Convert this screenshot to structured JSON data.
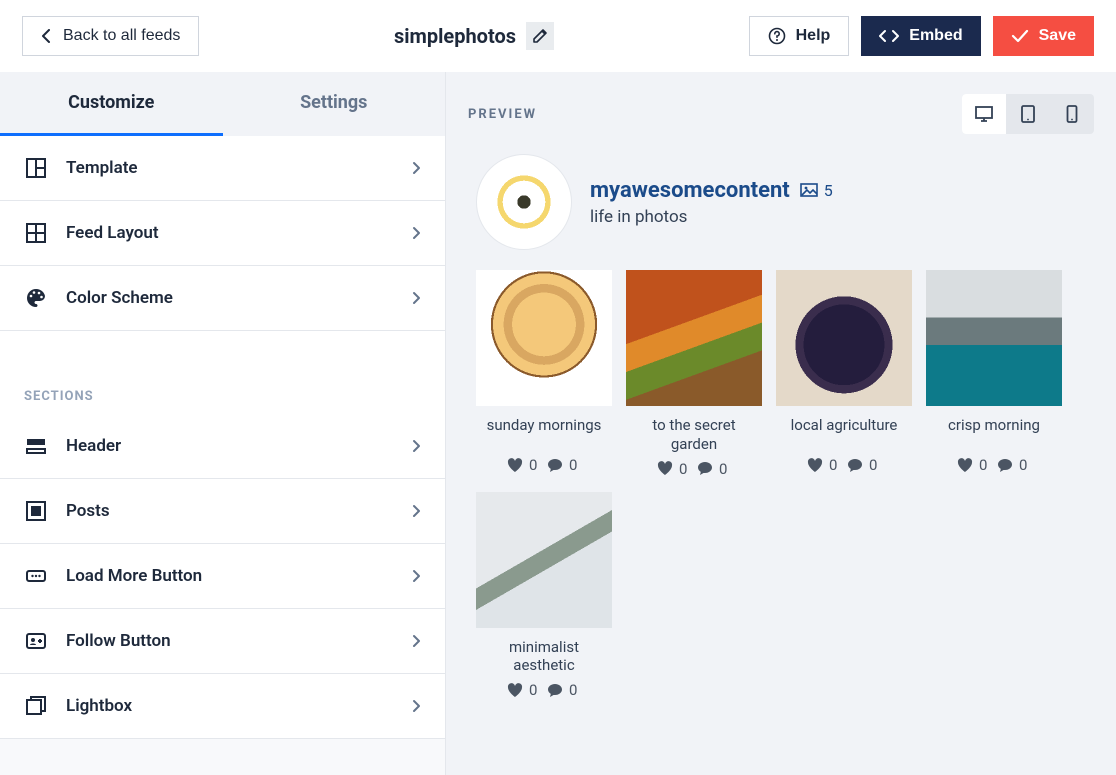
{
  "topbar": {
    "back_label": "Back to all feeds",
    "feed_title": "simplephotos",
    "help_label": "Help",
    "embed_label": "Embed",
    "save_label": "Save"
  },
  "tabs": {
    "customize": "Customize",
    "settings": "Settings"
  },
  "menu": {
    "template": "Template",
    "feed_layout": "Feed Layout",
    "color_scheme": "Color Scheme",
    "sections_label": "SECTIONS",
    "header": "Header",
    "posts": "Posts",
    "load_more": "Load More Button",
    "follow": "Follow Button",
    "lightbox": "Lightbox"
  },
  "preview": {
    "label": "PREVIEW",
    "username": "myawesomecontent",
    "image_count": "5",
    "tagline": "life in photos",
    "posts": [
      {
        "caption": "sunday mornings",
        "likes": "0",
        "comments": "0"
      },
      {
        "caption": "to the secret garden",
        "likes": "0",
        "comments": "0"
      },
      {
        "caption": "local agriculture",
        "likes": "0",
        "comments": "0"
      },
      {
        "caption": "crisp morning",
        "likes": "0",
        "comments": "0"
      },
      {
        "caption": "minimalist aesthetic",
        "likes": "0",
        "comments": "0"
      }
    ]
  }
}
